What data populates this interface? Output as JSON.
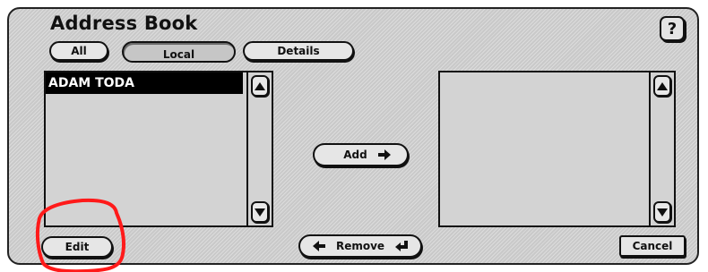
{
  "dialog": {
    "title": "Address Book",
    "help_label": "?"
  },
  "tabs": [
    {
      "label": "All"
    },
    {
      "label": "Local",
      "selected": true
    },
    {
      "label": "Details"
    }
  ],
  "local_list": {
    "items": [
      {
        "name": "ADAM TODA",
        "selected": true
      }
    ]
  },
  "selected_list": {
    "items": []
  },
  "buttons": {
    "add": "Add",
    "remove": "Remove",
    "edit": "Edit",
    "cancel": "Cancel"
  },
  "icons": {
    "scroll_up": "triangle-up-icon",
    "scroll_down": "triangle-down-icon",
    "add_arrow": "arrow-right-icon",
    "remove_arrow_left": "arrow-left-icon",
    "remove_arrow_return": "return-arrow-icon"
  },
  "annotation": {
    "color": "#ff1a1a",
    "target": "edit-button"
  }
}
